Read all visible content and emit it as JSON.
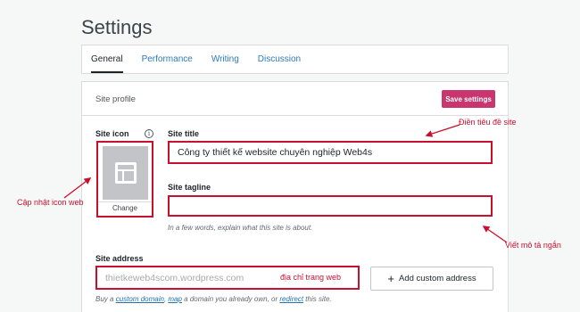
{
  "page": {
    "title": "Settings"
  },
  "tabs": [
    {
      "label": "General",
      "active": true
    },
    {
      "label": "Performance",
      "active": false
    },
    {
      "label": "Writing",
      "active": false
    },
    {
      "label": "Discussion",
      "active": false
    }
  ],
  "site_profile": {
    "header_label": "Site profile",
    "save_button": "Save settings",
    "site_icon": {
      "label": "Site icon",
      "info": "i",
      "change_button": "Change"
    },
    "site_title": {
      "label": "Site title",
      "value": "Công ty thiết kế website chuyên nghiệp Web4s"
    },
    "site_tagline": {
      "label": "Site tagline",
      "value": "",
      "help": "In a few words, explain what this site is about."
    },
    "site_address": {
      "label": "Site address",
      "placeholder": "thietkeweb4scom.wordpress.com",
      "add_custom_button": "Add custom address",
      "help": {
        "prefix": "Buy a ",
        "link1": "custom domain",
        "mid1": ", ",
        "link2": "map",
        "mid2": " a domain you already own, or ",
        "link3": "redirect",
        "suffix": " this site."
      }
    }
  },
  "annotations": {
    "site_title_note": "Điền tiêu đề site",
    "icon_note": "Cập nhật icon web",
    "tagline_note": "Viết mô tả ngắn",
    "address_note": "địa chỉ trang web"
  },
  "colors": {
    "accent": "#c9356e",
    "annotation": "#c8102e",
    "link": "#2271b1"
  }
}
